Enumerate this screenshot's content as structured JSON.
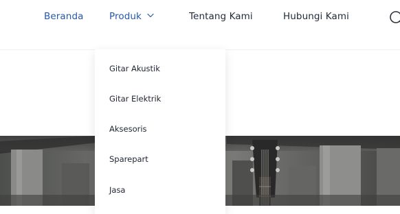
{
  "nav": {
    "items": [
      {
        "label": "Beranda"
      },
      {
        "label": "Produk"
      },
      {
        "label": "Tentang Kami"
      },
      {
        "label": "Hubungi Kami"
      }
    ]
  },
  "dropdown": {
    "items": [
      {
        "label": "Gitar Akustik"
      },
      {
        "label": "Gitar Elektrik"
      },
      {
        "label": "Aksesoris"
      },
      {
        "label": "Sparepart"
      },
      {
        "label": "Jasa"
      }
    ]
  },
  "colors": {
    "accent": "#2557a7",
    "text": "#1f2a37"
  },
  "icons": {
    "dropdown": "chevron-down-icon",
    "search": "search-icon"
  }
}
